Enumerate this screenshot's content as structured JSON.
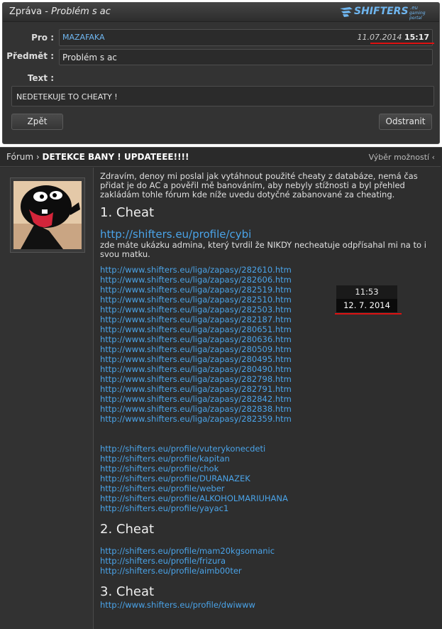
{
  "message": {
    "title_prefix": "Zpráva -",
    "title_subject": "Problém s ac",
    "logo_brand": "SHIFTERS",
    "logo_tld": ".eu",
    "logo_tag": "gaming portal",
    "pro_label": "Pro :",
    "pro_value": "MAZAFAKA",
    "date": "11.07.2014",
    "time": "15:17",
    "subject_label": "Předmět :",
    "subject_value": "Problém s ac",
    "text_label": "Text :",
    "text_value": "NEDETEKUJE TO CHEATY !",
    "back_button": "Zpět",
    "delete_button": "Odstranit"
  },
  "forum": {
    "breadcrumb_root": "Fórum",
    "breadcrumb_sep": " › ",
    "topic_title": "DETEKCE BANY ! UPDATEEE!!!!",
    "options_label": "Výběr možností ‹",
    "intro": "Zdravím, denoy mi poslal jak vytáhnout použité cheaty z databáze, nemá čas přidat je do AC a pověřil mě banováním, aby nebyly stížnosti a byl přehled zakládám tohle fórum kde níže uvedu dotyčné zabanované za cheating.",
    "cheat1_heading": "1. Cheat",
    "cheat1_profile": "http://shifters.eu/profile/cybi",
    "cheat1_note": "zde máte ukázku admina, který tvrdil že NIKDY necheatuje odpřísahal mi na to i svou matku.",
    "match_links": [
      "http://www.shifters.eu/liga/zapasy/282610.htm",
      "http://www.shifters.eu/liga/zapasy/282606.htm",
      "http://www.shifters.eu/liga/zapasy/282519.htm",
      "http://www.shifters.eu/liga/zapasy/282510.htm",
      "http://www.shifters.eu/liga/zapasy/282503.htm",
      "http://www.shifters.eu/liga/zapasy/282187.htm",
      "http://www.shifters.eu/liga/zapasy/280651.htm",
      "http://www.shifters.eu/liga/zapasy/280636.htm",
      "http://www.shifters.eu/liga/zapasy/280509.htm",
      "http://www.shifters.eu/liga/zapasy/280495.htm",
      "http://www.shifters.eu/liga/zapasy/280490.htm",
      "http://www.shifters.eu/liga/zapasy/282798.htm",
      "http://www.shifters.eu/liga/zapasy/282791.htm",
      "http://www.shifters.eu/liga/zapasy/282842.htm",
      "http://www.shifters.eu/liga/zapasy/282838.htm",
      "http://www.shifters.eu/liga/zapasy/282359.htm"
    ],
    "profile_links": [
      "http://shifters.eu/profile/vuterykonecdeti",
      "http://shifters.eu/profile/kapitan",
      "http://shifters.eu/profile/chok",
      "http://shifters.eu/profile/DURANAZEK",
      "http://shifters.eu/profile/weber",
      "http://shifters.eu/profile/ALKOHOLMARIUHANA",
      "http://shifters.eu/profile/yayac1"
    ],
    "cheat2_heading": "2. Cheat",
    "cheat2_links": [
      "http://shifters.eu/profile/mam20kgsomanic",
      "http://shifters.eu/profile/frizura",
      "http://shifters.eu/profile/aimb00ter"
    ],
    "cheat3_heading": "3. Cheat",
    "cheat3_partial": "http://www.shifters.eu/profile/dwiwww"
  },
  "clock": {
    "time": "11:53",
    "date": "12. 7. 2014"
  },
  "colors": {
    "link": "#4aa3e8",
    "panel": "#333333",
    "underline": "#dd1111"
  }
}
